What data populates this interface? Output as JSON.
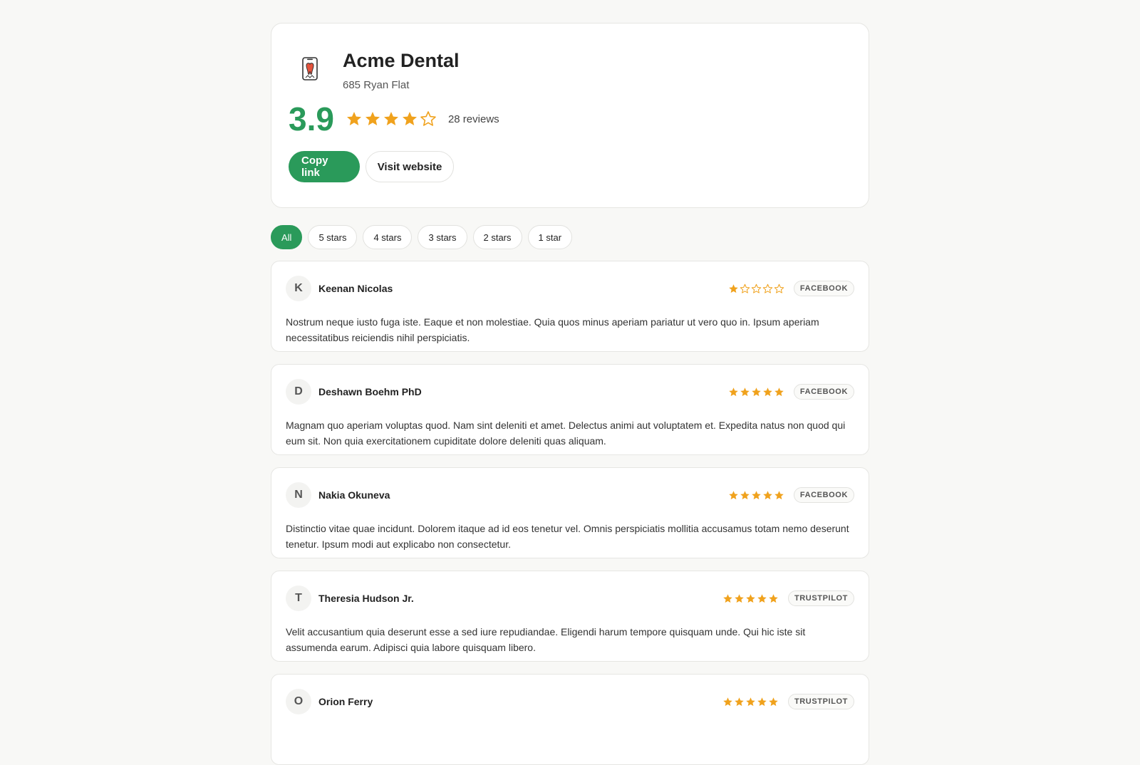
{
  "business": {
    "name": "Acme Dental",
    "address": "685 Ryan Flat",
    "rating": "3.9",
    "rating_value": 3.9,
    "review_count": "28 reviews"
  },
  "actions": {
    "copy_link": "Copy link",
    "visit_website": "Visit website"
  },
  "filters": [
    "All",
    "5 stars",
    "4 stars",
    "3 stars",
    "2 stars",
    "1 star"
  ],
  "colors": {
    "accent": "#2a9a5a",
    "star": "#f0a21d"
  },
  "reviews": [
    {
      "initial": "K",
      "name": "Keenan Nicolas",
      "stars": 1,
      "source": "FACEBOOK",
      "text": "Nostrum neque iusto fuga iste. Eaque et non molestiae. Quia quos minus aperiam pariatur ut vero quo in. Ipsum aperiam necessitatibus reiciendis nihil perspiciatis."
    },
    {
      "initial": "D",
      "name": "Deshawn Boehm PhD",
      "stars": 5,
      "source": "FACEBOOK",
      "text": "Magnam quo aperiam voluptas quod. Nam sint deleniti et amet. Delectus animi aut voluptatem et. Expedita natus non quod qui eum sit. Non quia exercitationem cupiditate dolore deleniti quas aliquam."
    },
    {
      "initial": "N",
      "name": "Nakia Okuneva",
      "stars": 5,
      "source": "FACEBOOK",
      "text": "Distinctio vitae quae incidunt. Dolorem itaque ad id eos tenetur vel. Omnis perspiciatis mollitia accusamus totam nemo deserunt tenetur. Ipsum modi aut explicabo non consectetur."
    },
    {
      "initial": "T",
      "name": "Theresia Hudson Jr.",
      "stars": 5,
      "source": "TRUSTPILOT",
      "text": "Velit accusantium quia deserunt esse a sed iure repudiandae. Eligendi harum tempore quisquam unde. Qui hic iste sit assumenda earum. Adipisci quia labore quisquam libero."
    },
    {
      "initial": "O",
      "name": "Orion Ferry",
      "stars": 5,
      "source": "TRUSTPILOT",
      "text": ""
    }
  ]
}
